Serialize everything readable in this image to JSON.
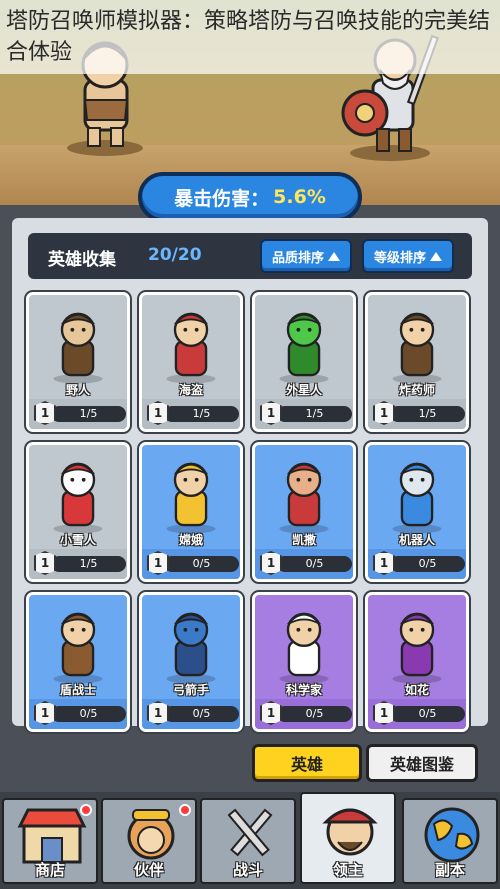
{
  "caption": "塔防召唤师模拟器：策略塔防与召唤技能的完美结合体验",
  "crit": {
    "label": "暴击伤害：",
    "value": "5.6%"
  },
  "collection": {
    "title": "英雄收集",
    "count": "20/20",
    "sort_quality": "品质排序",
    "sort_level": "等级排序"
  },
  "heroes": [
    {
      "name": "野人",
      "level": "1",
      "progress": "1/5",
      "rarity": "gray",
      "icon": "caveman-icon"
    },
    {
      "name": "海盗",
      "level": "1",
      "progress": "1/5",
      "rarity": "gray",
      "icon": "pirate-icon"
    },
    {
      "name": "外星人",
      "level": "1",
      "progress": "1/5",
      "rarity": "gray",
      "icon": "alien-icon"
    },
    {
      "name": "炸药师",
      "level": "1",
      "progress": "1/5",
      "rarity": "gray",
      "icon": "bomber-icon"
    },
    {
      "name": "小雪人",
      "level": "1",
      "progress": "1/5",
      "rarity": "gray",
      "icon": "snowman-icon"
    },
    {
      "name": "嫦娥",
      "level": "1",
      "progress": "0/5",
      "rarity": "blue",
      "icon": "change-icon"
    },
    {
      "name": "凯撒",
      "level": "1",
      "progress": "0/5",
      "rarity": "blue",
      "icon": "caesar-icon"
    },
    {
      "name": "机器人",
      "level": "1",
      "progress": "0/5",
      "rarity": "blue",
      "icon": "robot-icon"
    },
    {
      "name": "盾战士",
      "level": "1",
      "progress": "0/5",
      "rarity": "blue",
      "icon": "shield-warrior-icon"
    },
    {
      "name": "弓箭手",
      "level": "1",
      "progress": "0/5",
      "rarity": "blue",
      "icon": "archer-icon"
    },
    {
      "name": "科学家",
      "level": "1",
      "progress": "0/5",
      "rarity": "purple",
      "icon": "scientist-icon"
    },
    {
      "name": "如花",
      "level": "1",
      "progress": "0/5",
      "rarity": "purple",
      "icon": "ruhua-icon"
    }
  ],
  "tabs": {
    "hero": "英雄",
    "atlas": "英雄图鉴"
  },
  "nav": [
    {
      "label": "商店",
      "icon": "shop-icon"
    },
    {
      "label": "伙伴",
      "icon": "partner-icon"
    },
    {
      "label": "战斗",
      "icon": "swords-icon"
    },
    {
      "label": "领主",
      "icon": "lord-icon"
    },
    {
      "label": "副本",
      "icon": "globe-icon"
    }
  ],
  "colors": {
    "accent": "#2a86e0",
    "tab_active": "#ffd21f",
    "crit_value": "#ffe65a"
  }
}
